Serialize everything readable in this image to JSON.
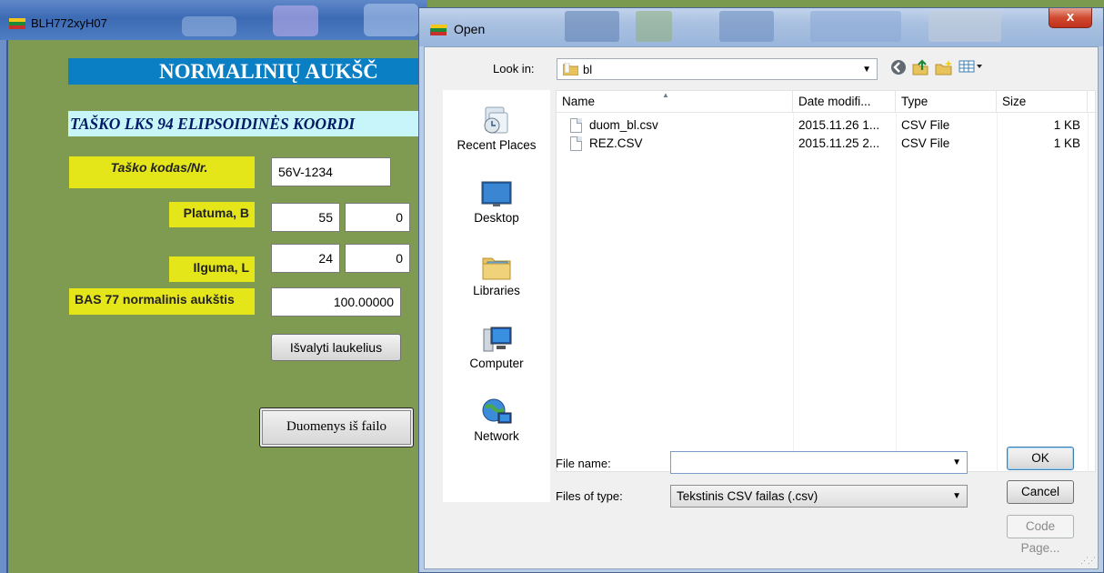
{
  "app": {
    "title": "BLH772xyH07",
    "heading": "NORMALINIŲ AUKŠČ",
    "subheading": "TAŠKO LKS 94 ELIPSOIDINĖS KOORDI",
    "point_code_label": "Taško kodas/Nr.",
    "point_code_value": "56V-1234",
    "latitude_label": "Platuma, B",
    "latitude_deg": "55",
    "latitude_min": "0",
    "longitude_label": "Ilguma, L",
    "longitude_deg": "24",
    "longitude_min": "0",
    "height_label": "BAS 77 normalinis aukštis",
    "height_value": "100.00000",
    "clear_button": "Išvalyti  laukelius",
    "from_file_button": "Duomenys iš failo"
  },
  "dialog": {
    "title": "Open",
    "close_symbol": "x",
    "look_in_label": "Look in:",
    "look_in_value": "bl",
    "places": [
      {
        "label": "Recent Places",
        "icon": "recent-places-icon"
      },
      {
        "label": "Desktop",
        "icon": "desktop-icon"
      },
      {
        "label": "Libraries",
        "icon": "libraries-icon"
      },
      {
        "label": "Computer",
        "icon": "computer-icon"
      },
      {
        "label": "Network",
        "icon": "network-icon"
      }
    ],
    "columns": [
      "Name",
      "Date modifi...",
      "Type",
      "Size"
    ],
    "files": [
      {
        "name": "duom_bl.csv",
        "date": "2015.11.26 1...",
        "type": "CSV File",
        "size": "1 KB"
      },
      {
        "name": "REZ.CSV",
        "date": "2015.11.25 2...",
        "type": "CSV File",
        "size": "1 KB"
      }
    ],
    "file_name_label": "File name:",
    "file_name_value": "",
    "files_of_type_label": "Files of type:",
    "files_of_type_value": "Tekstinis CSV failas (.csv)",
    "ok_button": "OK",
    "cancel_button": "Cancel",
    "code_page_button": "Code Page..."
  },
  "colors": {
    "app_background": "#7f9b52",
    "heading_bar": "#0a7fc4",
    "label_yellow": "#e5e61a",
    "subheading_bg": "#c8f5f9"
  }
}
